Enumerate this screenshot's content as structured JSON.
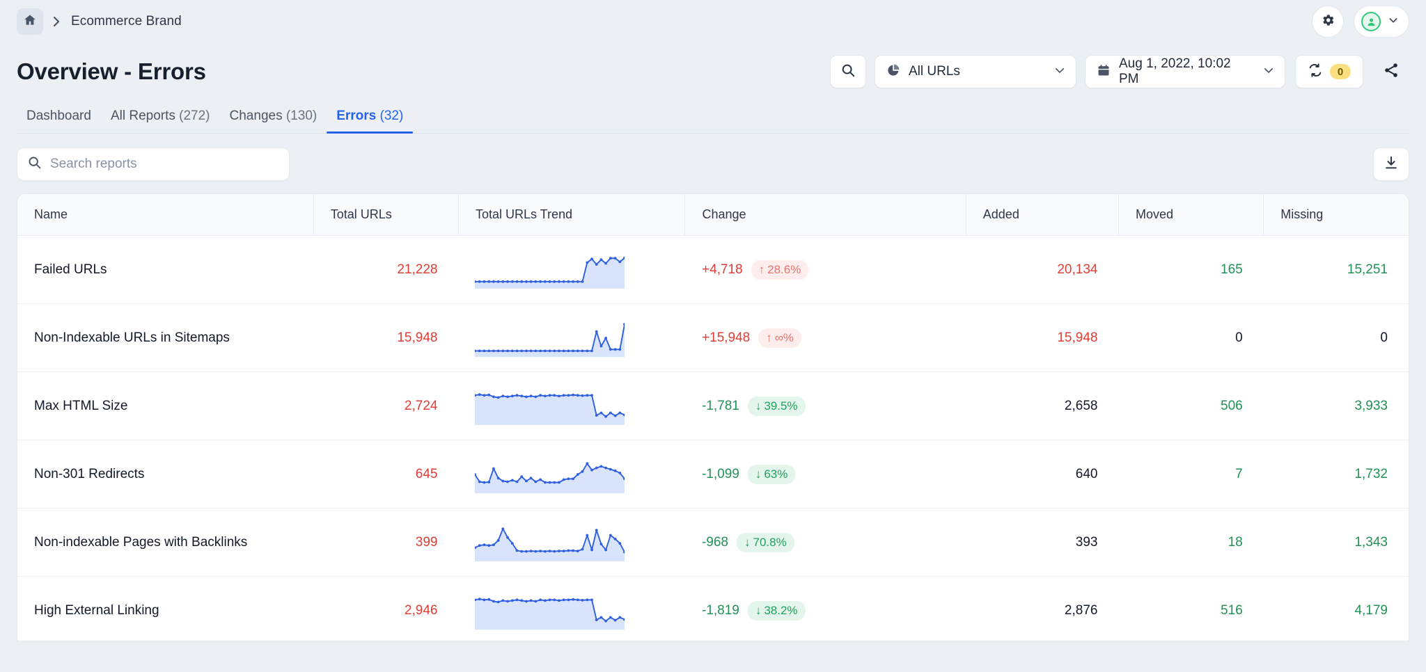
{
  "breadcrumb": {
    "home_icon": "home-icon",
    "separator": "chevron-right-icon",
    "label": "Ecommerce Brand"
  },
  "header": {
    "title": "Overview - Errors",
    "settings_icon": "gear-icon",
    "account_icon": "user-circle-icon",
    "account_chevron": "chevron-down-icon"
  },
  "controls": {
    "search_icon": "search-icon",
    "segment": {
      "icon": "pie-chart-icon",
      "value": "All URLs",
      "chevron": "chevron-down-icon"
    },
    "date": {
      "icon": "calendar-icon",
      "value": "Aug 1, 2022, 10:02 PM",
      "chevron": "chevron-down-icon"
    },
    "sync": {
      "icon": "refresh-icon",
      "badge": "0"
    },
    "share_icon": "share-icon"
  },
  "tabs": [
    {
      "label": "Dashboard",
      "count": "",
      "active": false
    },
    {
      "label": "All Reports",
      "count": "(272)",
      "active": false
    },
    {
      "label": "Changes",
      "count": "(130)",
      "active": false
    },
    {
      "label": "Errors",
      "count": "(32)",
      "active": true
    }
  ],
  "toolbar": {
    "search_placeholder": "Search reports",
    "search_value": "",
    "search_icon": "search-icon",
    "download_icon": "download-icon"
  },
  "table": {
    "columns": [
      "Name",
      "Total URLs",
      "Total URLs Trend",
      "Change",
      "Added",
      "Moved",
      "Missing"
    ],
    "rows": [
      {
        "name": "Failed URLs",
        "total": "21,228",
        "total_color": "red",
        "change": "+4,718",
        "change_color": "red",
        "pill": "28.6%",
        "pill_dir": "up",
        "added": "20,134",
        "added_color": "red",
        "moved": "165",
        "moved_color": "green",
        "missing": "15,251",
        "missing_color": "green",
        "trend": [
          8,
          8,
          8,
          8,
          8,
          8,
          8,
          8,
          8,
          8,
          8,
          8,
          8,
          8,
          8,
          8,
          8,
          8,
          8,
          8,
          8,
          8,
          8,
          8,
          60,
          70,
          55,
          68,
          58,
          72,
          72,
          62,
          73
        ],
        "trend_max": 80
      },
      {
        "name": "Non-Indexable URLs in Sitemaps",
        "total": "15,948",
        "total_color": "red",
        "change": "+15,948",
        "change_color": "red",
        "pill": "∞%",
        "pill_dir": "up",
        "added": "15,948",
        "added_color": "red",
        "moved": "0",
        "moved_color": "dark",
        "missing": "0",
        "missing_color": "dark",
        "trend": [
          5,
          5,
          5,
          5,
          5,
          5,
          5,
          5,
          5,
          5,
          5,
          5,
          5,
          5,
          5,
          5,
          5,
          5,
          5,
          5,
          5,
          5,
          5,
          5,
          5,
          5,
          58,
          18,
          40,
          9,
          9,
          9,
          78
        ],
        "trend_max": 80
      },
      {
        "name": "Max HTML Size",
        "total": "2,724",
        "total_color": "red",
        "change": "-1,781",
        "change_color": "green",
        "pill": "39.5%",
        "pill_dir": "down",
        "added": "2,658",
        "added_color": "dark",
        "moved": "506",
        "moved_color": "green",
        "missing": "3,933",
        "missing_color": "green",
        "trend": [
          70,
          72,
          70,
          71,
          66,
          64,
          68,
          66,
          68,
          70,
          68,
          66,
          68,
          66,
          70,
          68,
          70,
          70,
          68,
          70,
          70,
          71,
          70,
          69,
          70,
          70,
          15,
          22,
          12,
          22,
          14,
          22,
          16
        ],
        "trend_max": 80
      },
      {
        "name": "Non-301 Redirects",
        "total": "645",
        "total_color": "red",
        "change": "-1,099",
        "change_color": "green",
        "pill": "63%",
        "pill_dir": "down",
        "added": "640",
        "added_color": "dark",
        "moved": "7",
        "moved_color": "green",
        "missing": "1,732",
        "missing_color": "green",
        "trend": [
          40,
          20,
          18,
          19,
          56,
          30,
          22,
          20,
          24,
          20,
          34,
          22,
          30,
          20,
          26,
          18,
          18,
          18,
          18,
          26,
          28,
          28,
          40,
          48,
          70,
          52,
          58,
          62,
          58,
          54,
          50,
          44,
          28
        ],
        "trend_max": 80
      },
      {
        "name": "Non-indexable Pages with Backlinks",
        "total": "399",
        "total_color": "red",
        "change": "-968",
        "change_color": "green",
        "pill": "70.8%",
        "pill_dir": "down",
        "added": "393",
        "added_color": "dark",
        "moved": "18",
        "moved_color": "green",
        "missing": "1,343",
        "missing_color": "green",
        "trend": [
          26,
          32,
          34,
          32,
          34,
          46,
          78,
          54,
          38,
          18,
          16,
          16,
          17,
          16,
          17,
          16,
          17,
          16,
          17,
          17,
          18,
          18,
          17,
          22,
          60,
          20,
          74,
          36,
          20,
          60,
          50,
          38,
          14
        ],
        "trend_max": 80
      },
      {
        "name": "High External Linking",
        "total": "2,946",
        "total_color": "red",
        "change": "-1,819",
        "change_color": "green",
        "pill": "38.2%",
        "pill_dir": "down",
        "added": "2,876",
        "added_color": "dark",
        "moved": "516",
        "moved_color": "green",
        "missing": "4,179",
        "missing_color": "green",
        "trend": [
          70,
          72,
          70,
          71,
          66,
          64,
          68,
          66,
          68,
          70,
          68,
          66,
          68,
          66,
          70,
          68,
          70,
          70,
          68,
          70,
          70,
          71,
          70,
          69,
          70,
          70,
          15,
          22,
          12,
          22,
          14,
          22,
          16
        ],
        "trend_max": 80
      }
    ]
  },
  "colors": {
    "accent": "#2563eb",
    "red": "#e23c34",
    "green": "#1f9254",
    "badge_yellow": "#fbdf7e",
    "page_bg": "#eceff3"
  }
}
